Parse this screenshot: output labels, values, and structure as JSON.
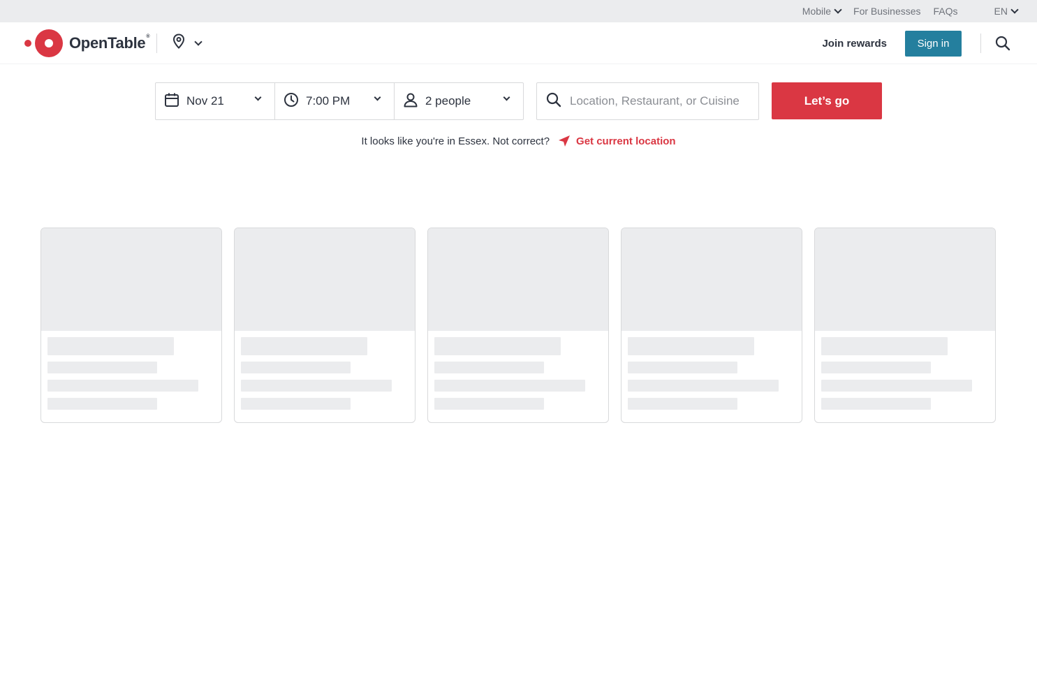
{
  "util_bar": {
    "mobile": "Mobile",
    "for_businesses": "For Businesses",
    "faqs": "FAQs",
    "language": "EN"
  },
  "header": {
    "logo_text": "OpenTable",
    "logo_reg": "®",
    "join_rewards": "Join rewards",
    "sign_in": "Sign in"
  },
  "search": {
    "date": "Nov 21",
    "time": "7:00 PM",
    "party": "2 people",
    "placeholder": "Location, Restaurant, or Cuisine",
    "go": "Let’s go"
  },
  "location_hint": {
    "text": "It looks like you're in Essex. Not correct?",
    "link": "Get current location"
  },
  "colors": {
    "brand_red": "#da3743",
    "signin_blue": "#247f9e",
    "skeleton": "#ebecee"
  },
  "icons": [
    "location-pin-icon",
    "search-icon",
    "calendar-icon",
    "clock-icon",
    "person-icon",
    "navigation-arrow-icon",
    "chevron-down-icon"
  ],
  "loading_cards": 5
}
